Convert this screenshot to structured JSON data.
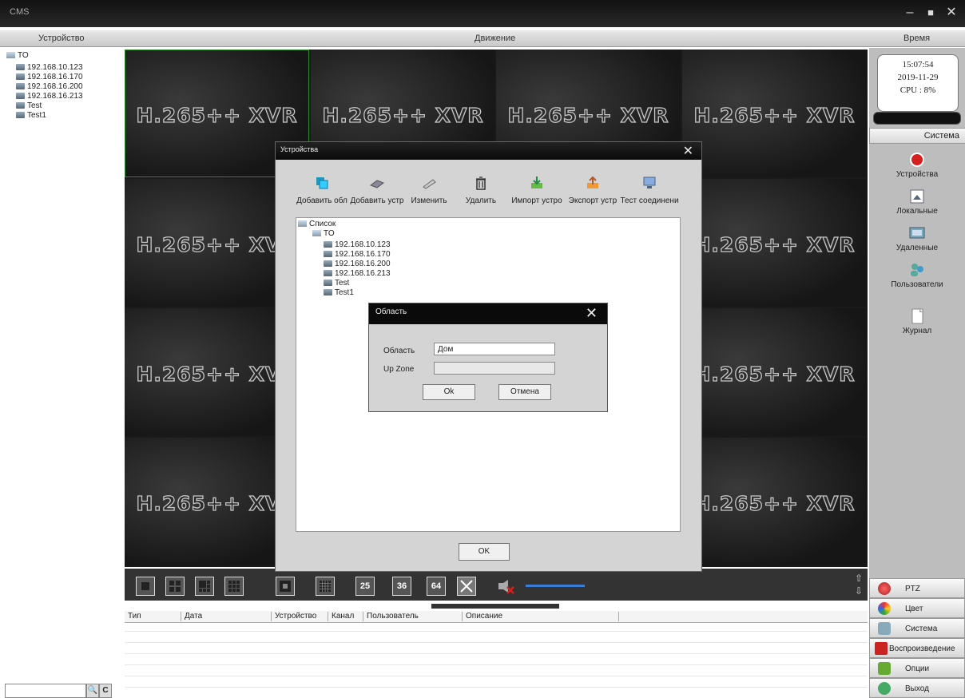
{
  "window": {
    "title": "CMS",
    "min": "–",
    "max": "■",
    "close": "✕"
  },
  "headers": {
    "device": "Устройство",
    "motion": "Движение",
    "time": "Время"
  },
  "tree": {
    "root": "TO",
    "devices": [
      "192.168.10.123",
      "192.168.16.170",
      "192.168.16.200",
      "192.168.16.213",
      "Test",
      "Test1"
    ]
  },
  "video": {
    "brand_text": "H.265++ XVR"
  },
  "status": {
    "time": "15:07:54",
    "date": "2019-11-29",
    "cpu": "CPU : 8%"
  },
  "right_panel": {
    "tab": "Система",
    "items": [
      "Устройства",
      "Локальные",
      "Удаленные",
      "Пользователи",
      "Журнал"
    ]
  },
  "layout_buttons": [
    "25",
    "36",
    "64"
  ],
  "right_menu": [
    "PTZ",
    "Цвет",
    "Система",
    "Воспроизведение",
    "Опции",
    "Выход"
  ],
  "log_table": {
    "columns": [
      "Тип",
      "Дата",
      "Устройство",
      "Канал",
      "Пользователь",
      "Описание"
    ]
  },
  "devices_dialog": {
    "title": "Устройства",
    "toolbar": [
      "Добавить обл",
      "Добавить устр",
      "Изменить",
      "Удалить",
      "Импорт устро",
      "Экспорт устр",
      "Тест соединени"
    ],
    "tree_root": "Список",
    "tree_group": "TO",
    "tree_items": [
      "192.168.10.123",
      "192.168.16.170",
      "192.168.16.200",
      "192.168.16.213",
      "Test",
      "Test1"
    ],
    "ok_label": "OK"
  },
  "area_dialog": {
    "title": "Область",
    "area_label": "Область",
    "area_value": "Дом",
    "upzone_label": "Up Zone",
    "upzone_value": "",
    "ok_label": "Ok",
    "cancel_label": "Отмена"
  },
  "colors": {
    "selected_border": "#2a8a2a",
    "dialog_title_bg": "#0a0a0a",
    "accent_red": "#d62020"
  }
}
